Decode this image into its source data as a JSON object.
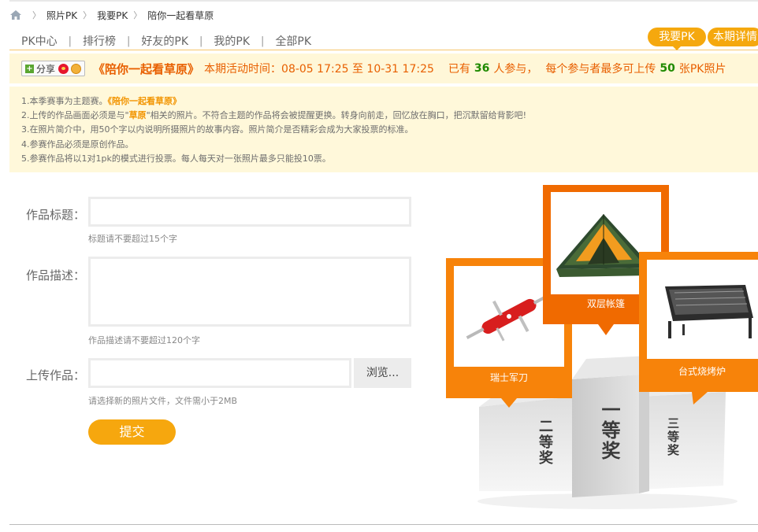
{
  "breadcrumb": {
    "items": [
      "照片PK",
      "我要PK",
      "陪你一起看草原"
    ]
  },
  "nav": {
    "items": [
      "PK中心",
      "排行榜",
      "好友的PK",
      "我的PK",
      "全部PK"
    ],
    "separator": "|"
  },
  "tabs": {
    "active": "我要PK",
    "other": "本期详情"
  },
  "infobar": {
    "share_label": "分享",
    "title": "《陪你一起看草原》",
    "period_text": "本期活动时间：08-05 17:25 至 10-31 17:25",
    "participants_prefix": "已有",
    "participants_count": "36",
    "participants_suffix": "人参与，",
    "upload_prefix": "每个参与者最多可上传",
    "upload_count": "50",
    "upload_suffix": "张PK照片"
  },
  "rules": {
    "r1_prefix": "1.本季赛事为主题赛。",
    "r1_highlight": "《陪你一起看草原》",
    "r2_prefix": "2.上传的作品画面必须是与\"",
    "r2_highlight": "草原",
    "r2_suffix": "\"相关的照片。不符合主题的作品将会被提醒更换。转身向前走，回忆放在胸口，把沉默留给背影吧!",
    "r3": "3.在照片简介中，用50个字以内说明所摄照片的故事内容。照片简介是否精彩会成为大家投票的标准。",
    "r4": "4.参赛作品必须是原创作品。",
    "r5": "5.参赛作品将以1对1pk的模式进行投票。每人每天对一张照片最多只能投10票。"
  },
  "form": {
    "title_label": "作品标题：",
    "title_value": "",
    "title_hint": "标题请不要超过15个字",
    "desc_label": "作品描述：",
    "desc_value": "",
    "desc_hint": "作品描述请不要超过120个字",
    "upload_label": "上传作品：",
    "upload_value": "",
    "browse_label": "浏览...",
    "upload_hint": "请选择新的照片文件，文件需小于2MB",
    "submit_label": "提交"
  },
  "prizes": {
    "first": {
      "name": "双层帐篷",
      "rank": "一等奖"
    },
    "second": {
      "name": "瑞士军刀",
      "rank": "二等奖"
    },
    "third": {
      "name": "台式烧烤炉",
      "rank": "三等奖"
    }
  },
  "colors": {
    "accent_orange": "#f5a80e",
    "prize_orange": "#f7830a",
    "prize_orange_dark": "#f06a00",
    "title_orange": "#e85f00",
    "count_green": "#1f8a00",
    "infobar_bg": "#fff7d8"
  },
  "icons": {
    "home": "home-icon",
    "share_plus": "plus-icon",
    "weibo": "weibo-icon",
    "smiley": "smiley-icon"
  }
}
